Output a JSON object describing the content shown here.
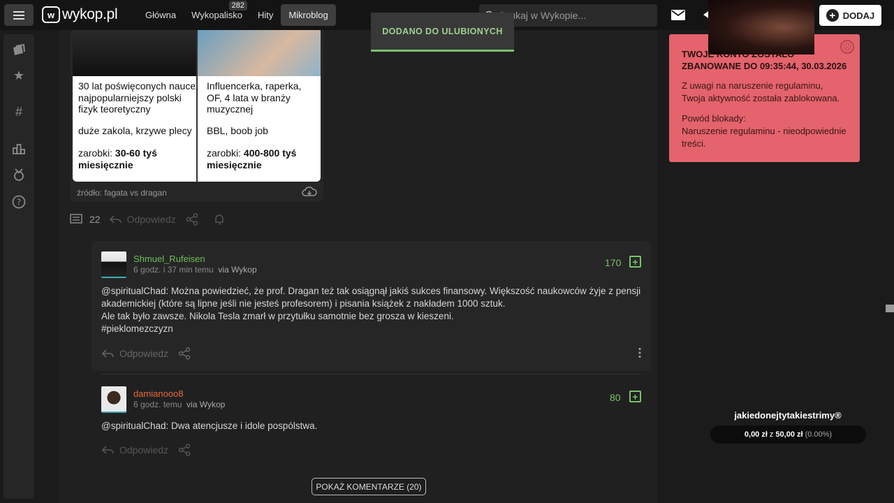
{
  "topbar": {
    "logo_text": "wykop.pl",
    "logo_mark": "w",
    "nav": [
      {
        "label": "Główna"
      },
      {
        "label": "Wykopalisko",
        "badge": "282"
      },
      {
        "label": "Hity"
      },
      {
        "label": "Mikroblog",
        "active": true
      }
    ],
    "search_placeholder": "Szukaj w Wykopie...",
    "add_label": "DODAJ"
  },
  "toast": {
    "text": "DODANO DO ULUBIONYCH"
  },
  "entry": {
    "meme": {
      "left_col": {
        "line1": "30 lat poświęconych nauce, najpopularniejszy polski fizyk teoretyczny",
        "line2": "duże zakola, krzywe plecy",
        "salary_prefix": "zarobki: ",
        "salary": "30-60 tyś miesięcznie"
      },
      "right_col": {
        "line1": "Influencerka, raperka, OF, 4 lata w branży muzycznej",
        "line2": "BBL, boob job",
        "salary_prefix": "zarobki: ",
        "salary": "400-800 tyś miesięcznie"
      }
    },
    "source": "źródło: fagata vs dragan",
    "comments_count": "22",
    "reply_label": "Odpowiedz"
  },
  "comments": [
    {
      "username": "Shmuel_Rufeisen",
      "username_color": "#6dbf5a",
      "time": "6 godz. i 37 min temu",
      "via": "via Wykop",
      "score": "170",
      "mention": "@spiritualChad:",
      "text1": "Można powiedzieć, że prof. Dragan też tak osiągnął jakiś sukces finansowy. Większość naukowców żyje z pensji akademickiej (które są lipne jeśli nie jesteś profesorem) i pisania książek z nakładem 1000 sztuk.",
      "text2": "Ale tak było zawsze. Nikola Tesla zmarł w przytułku samotnie bez grosza w kieszeni.",
      "tag": "#pieklomezczyzn",
      "reply_label": "Odpowiedz"
    },
    {
      "username": "damianooo8",
      "username_color": "#e86a3a",
      "time": "6 godz. temu",
      "via": "via Wykop",
      "score": "80",
      "mention": "@spiritualChad:",
      "text1": "Dwa atencjusze i idole pospólstwa.",
      "reply_label": "Odpowiedz"
    }
  ],
  "show_comments_label": "POKAŻ KOMENTARZE (20)",
  "ban": {
    "title": "TWOJE KONTO ZOSTAŁO ZBANOWANE DO 09:35:44, 30.03.2026",
    "text1": "Z uwagi na naruszenie regulaminu, Twoja aktywność została zablokowana.",
    "reason_label": "Powód blokady:",
    "reason": "Naruszenie regulaminu - nieodpowiednie treści."
  },
  "donation": {
    "title": "jakiedonejtytakiestrimy®",
    "current": "0,00 zł",
    "sep": "z",
    "goal": "50,00 zł",
    "percent": "(0.00%)"
  },
  "colors": {
    "accent_green": "#7ac26d",
    "ban_bg": "#e4636c"
  },
  "icons": [
    "menu-icon",
    "search-icon",
    "mail-icon",
    "bell-icon",
    "plus-icon",
    "comment-icon",
    "reply-icon",
    "share-icon",
    "bell-add-icon",
    "cloud-download-icon",
    "more-icon",
    "sad-face-icon"
  ]
}
